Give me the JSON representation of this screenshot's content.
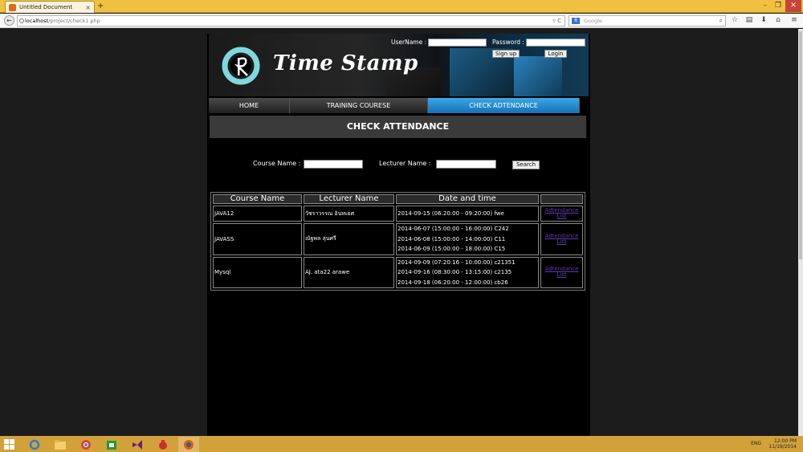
{
  "browser": {
    "tab_title": "Untitled Document",
    "url_host": "localhost",
    "url_path": "/project/check1.php",
    "search_placeholder": "Google"
  },
  "site": {
    "logo_text": "Time Stamp",
    "username_label": "UserName :",
    "password_label": "Password :",
    "signup_label": "Sign up",
    "login_label": "Login",
    "menu": [
      "HOME",
      "TRAINING COURESE",
      "CHECK ADTENDANCE"
    ],
    "active_menu": "CHECK ADTENDANCE",
    "section_title": "CHECK ATTENDANCE",
    "course_name_label": "Course Name :",
    "lecturer_name_label": "Lecturer Name :",
    "search_button": "Search",
    "table_headers": [
      "Course Name",
      "Lecturer Name",
      "Date and time",
      ""
    ],
    "rows": [
      {
        "course": "JAVA12",
        "lecturer": "วัชราวรรณ อินทเยศ",
        "dates": [
          "2014-09-15 (06:20:00 - 09:20:00) fwe"
        ],
        "link_line1": "Adtendance",
        "link_line2": "List"
      },
      {
        "course": "JAVASS",
        "lecturer": "ณัฐพล ลุ่นศรี",
        "dates": [
          "2014-06-07 (15:00:00 - 16:00:00) C242",
          "2014-06-08 (15:00:00 - 14:00:00) C11",
          "2014-06-09 (15:00:00 - 18:00:00) C15"
        ],
        "link_line1": "Adtendance",
        "link_line2": "List"
      },
      {
        "course": "Mysql",
        "lecturer": "AJ. ata22  arawe",
        "dates": [
          "2014-09-09 (07:20:16 - 10:00:00) c21351",
          "2014-09-16 (08:30:00 - 13:15:00) c2135",
          "2014-09-18 (06:20:00 - 12:00:00) cb26"
        ],
        "link_line1": "Adtendance",
        "link_line2": "List"
      }
    ]
  },
  "taskbar": {
    "lang": "ENG",
    "time": "12:00 PM",
    "date": "11/19/2014"
  },
  "colors": {
    "active_menu": "#1e8ad6",
    "link": "#5b3fa8",
    "taskbar": "#d2a13a",
    "titlebar": "#f0c040"
  }
}
